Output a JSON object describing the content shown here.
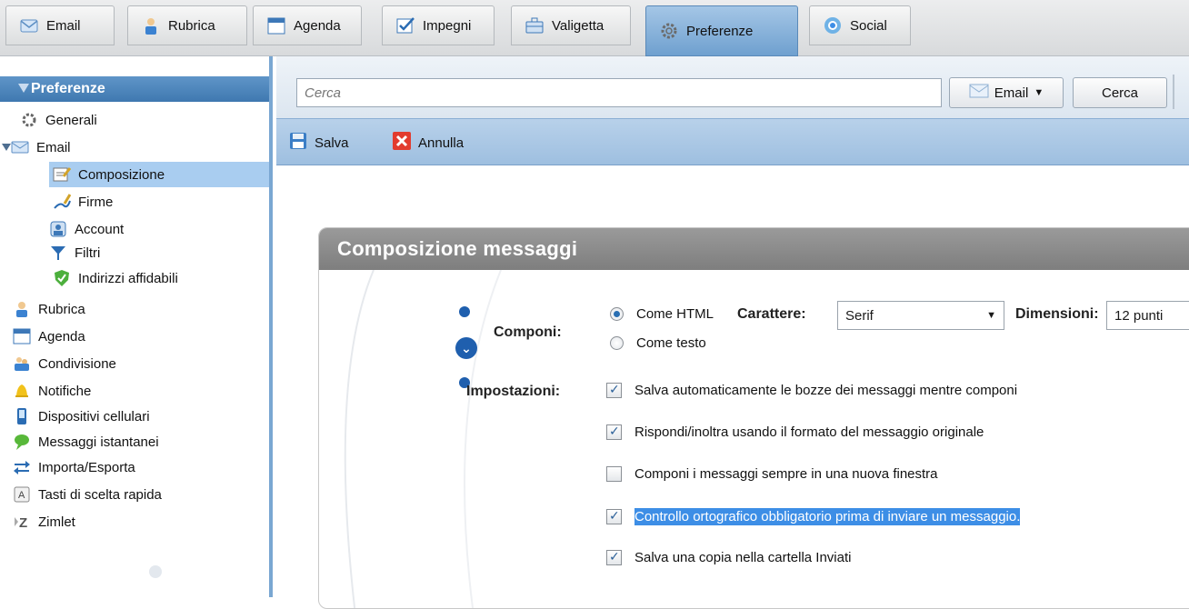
{
  "tabs": [
    {
      "label": "Email",
      "icon": "email-icon"
    },
    {
      "label": "Rubrica",
      "icon": "contacts-icon"
    },
    {
      "label": "Agenda",
      "icon": "calendar-icon"
    },
    {
      "label": "Impegni",
      "icon": "tasks-icon"
    },
    {
      "label": "Valigetta",
      "icon": "briefcase-icon"
    },
    {
      "label": "Preferenze",
      "icon": "gear-icon"
    },
    {
      "label": "Social",
      "icon": "social-icon"
    }
  ],
  "active_tab": "Preferenze",
  "sidebar": {
    "header": "Preferenze",
    "items": [
      {
        "label": "Generali"
      },
      {
        "label": "Email"
      },
      {
        "label": "Composizione"
      },
      {
        "label": "Firme"
      },
      {
        "label": "Account"
      },
      {
        "label": "Filtri"
      },
      {
        "label": "Indirizzi affidabili"
      },
      {
        "label": "Rubrica"
      },
      {
        "label": "Agenda"
      },
      {
        "label": "Condivisione"
      },
      {
        "label": "Notifiche"
      },
      {
        "label": "Dispositivi cellulari"
      },
      {
        "label": "Messaggi istantanei"
      },
      {
        "label": "Importa/Esporta"
      },
      {
        "label": "Tasti di scelta rapida"
      },
      {
        "label": "Zimlet"
      }
    ]
  },
  "search": {
    "placeholder": "Cerca",
    "type_label": "Email",
    "button": "Cerca"
  },
  "toolbar": {
    "save": "Salva",
    "cancel": "Annulla"
  },
  "panel": {
    "title": "Composizione messaggi",
    "compose_label": "Componi:",
    "compose_html": "Come HTML",
    "compose_text": "Come testo",
    "font_label": "Carattere:",
    "font_value": "Serif",
    "size_label": "Dimensioni:",
    "size_value": "12 punti",
    "settings_label": "Impostazioni:",
    "settings": [
      {
        "label": "Salva automaticamente le bozze dei messaggi mentre componi",
        "checked": true
      },
      {
        "label": "Rispondi/inoltra usando il formato del messaggio originale",
        "checked": true
      },
      {
        "label": "Componi i messaggi sempre in una nuova finestra",
        "checked": false
      },
      {
        "label": "Controllo ortografico obbligatorio prima di inviare un messaggio.",
        "checked": true
      },
      {
        "label": "Salva una copia nella cartella Inviati",
        "checked": true
      }
    ]
  },
  "colors": {
    "accent": "#3f78b0",
    "selection": "#a9cdf0",
    "highlight": "#3d8ee6"
  }
}
